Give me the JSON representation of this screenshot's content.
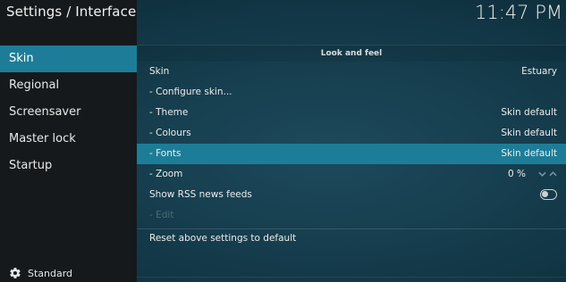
{
  "header": {
    "title": "Settings / Interface",
    "clock": "11:47 PM"
  },
  "sidebar": {
    "items": [
      {
        "label": "Skin",
        "active": true
      },
      {
        "label": "Regional",
        "active": false
      },
      {
        "label": "Screensaver",
        "active": false
      },
      {
        "label": "Master lock",
        "active": false
      },
      {
        "label": "Startup",
        "active": false
      }
    ],
    "footer": {
      "icon": "gear-icon",
      "label": "Standard"
    }
  },
  "main": {
    "section_title": "Look and feel",
    "rows": [
      {
        "label": "Skin",
        "value": "Estuary"
      },
      {
        "label": "- Configure skin...",
        "value": ""
      },
      {
        "label": "- Theme",
        "value": "Skin default"
      },
      {
        "label": "- Colours",
        "value": "Skin default"
      },
      {
        "label": "- Fonts",
        "value": "Skin default",
        "active": true
      },
      {
        "label": "- Zoom",
        "value": "0 %",
        "control": "spinner"
      },
      {
        "label": "Show RSS news feeds",
        "value": "",
        "control": "toggle",
        "checked": false
      },
      {
        "label": "- Edit",
        "value": "",
        "disabled": true
      }
    ],
    "reset_label": "Reset above settings to default"
  },
  "colors": {
    "accent": "#1d7d98",
    "sidebar_bg": "#15191c",
    "content_bg": "#123746"
  }
}
